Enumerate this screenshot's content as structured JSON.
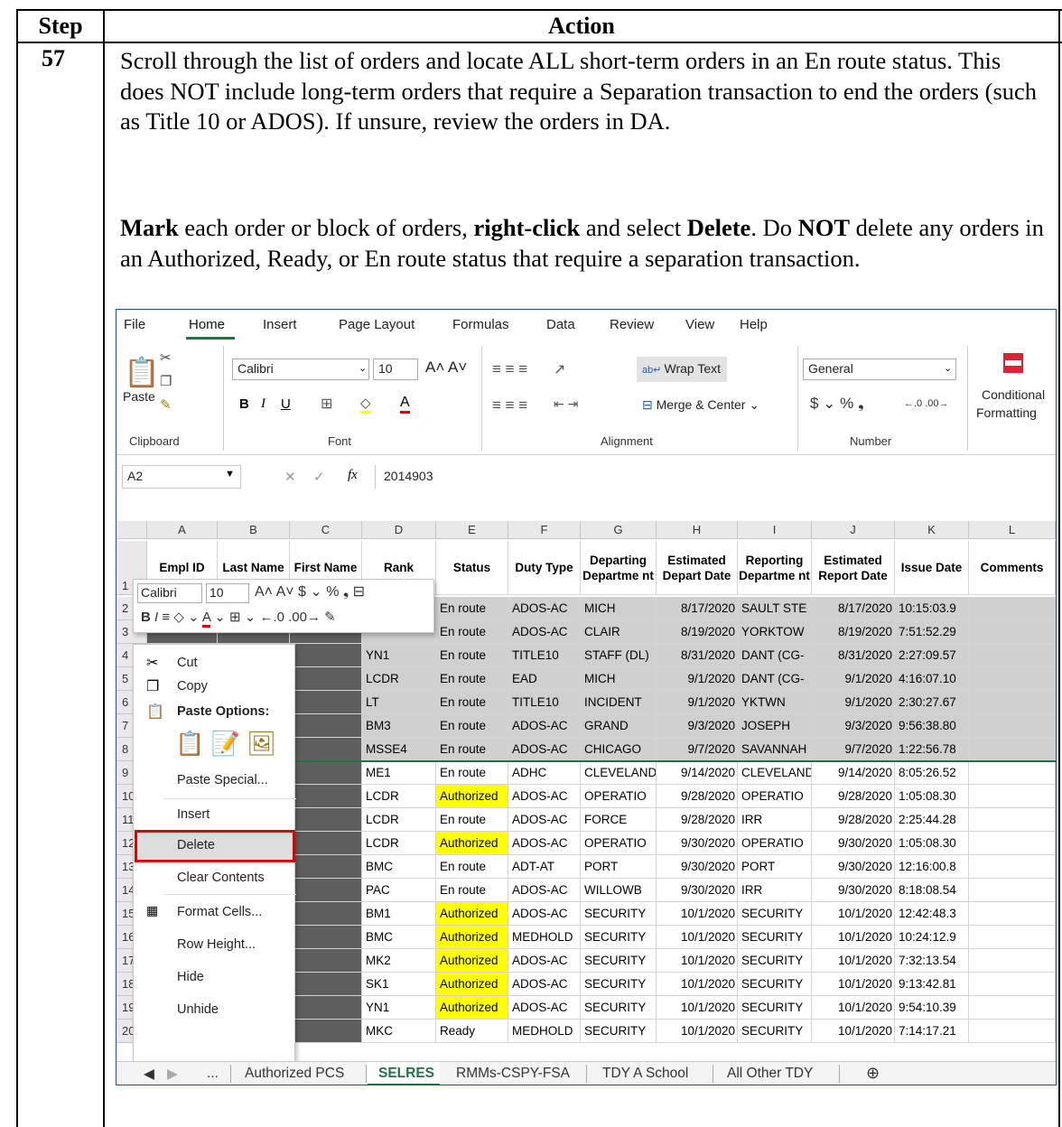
{
  "table": {
    "step_header": "Step",
    "action_header": "Action",
    "step_number": "57"
  },
  "instructions": {
    "p1": "Scroll through the list of orders and locate ALL short-term orders in an En route status.  This does NOT include long-term orders that require a Separation transaction to end the orders (such as Title 10 or ADOS).  If unsure, review the orders in DA.",
    "p2_mark": "Mark",
    "p2_a": " each order or block of orders, ",
    "p2_right": "right-click",
    "p2_b": " and select ",
    "p2_delete": "Delete",
    "p2_c": ".  Do ",
    "p2_not": "NOT",
    "p2_d": " delete any orders in an Authorized, Ready, or En route status that require a separation transaction."
  },
  "excel": {
    "menu": [
      "File",
      "Home",
      "Insert",
      "Page Layout",
      "Formulas",
      "Data",
      "Review",
      "View",
      "Help"
    ],
    "active_menu": "Home",
    "ribbon": {
      "paste": "Paste",
      "font_name": "Calibri",
      "font_size": "10",
      "wrap_text": "Wrap Text",
      "merge_center": "Merge & Center",
      "number_format": "General",
      "conditional": "Conditional",
      "formatting": "Formatting",
      "groups": [
        "Clipboard",
        "Font",
        "Alignment",
        "Number"
      ]
    },
    "name_box": "A2",
    "formula": "2014903",
    "fx": "fx",
    "columns": [
      "A",
      "B",
      "C",
      "D",
      "E",
      "F",
      "G",
      "H",
      "I",
      "J",
      "K",
      "L"
    ],
    "headers": [
      "Empl ID",
      "Last Name",
      "First Name",
      "Rank",
      "Status",
      "Duty Type",
      "Departing Departme nt",
      "Estimated Depart Date",
      "Reporting Departme nt",
      "Estimated Report Date",
      "Issue Date",
      "Comments"
    ],
    "rows": [
      {
        "n": "2",
        "rank": "",
        "status": "En route",
        "duty": "ADOS-AC",
        "dep": "MICH",
        "dd": "8/17/2020",
        "rep": "SAULT STE",
        "rd": "8/17/2020",
        "iss": "10:15:03.9"
      },
      {
        "n": "3",
        "rank": "",
        "status": "En route",
        "duty": "ADOS-AC",
        "dep": "CLAIR",
        "dd": "8/19/2020",
        "rep": "YORKTOW",
        "rd": "8/19/2020",
        "iss": "7:51:52.29"
      },
      {
        "n": "4",
        "rank": "YN1",
        "status": "En route",
        "duty": "TITLE10",
        "dep": "STAFF (DL)",
        "dd": "8/31/2020",
        "rep": "DANT (CG-",
        "rd": "8/31/2020",
        "iss": "2:27:09.57"
      },
      {
        "n": "5",
        "rank": "LCDR",
        "status": "En route",
        "duty": "EAD",
        "dep": "MICH",
        "dd": "9/1/2020",
        "rep": "DANT (CG-",
        "rd": "9/1/2020",
        "iss": "4:16:07.10"
      },
      {
        "n": "6",
        "rank": "LT",
        "status": "En route",
        "duty": "TITLE10",
        "dep": "INCIDENT",
        "dd": "9/1/2020",
        "rep": "YKTWN",
        "rd": "9/1/2020",
        "iss": "2:30:27.67"
      },
      {
        "n": "7",
        "rank": "BM3",
        "status": "En route",
        "duty": "ADOS-AC",
        "dep": "GRAND",
        "dd": "9/3/2020",
        "rep": "JOSEPH",
        "rd": "9/3/2020",
        "iss": "9:56:38.80"
      },
      {
        "n": "8",
        "rank": "MSSE4",
        "status": "En route",
        "duty": "ADOS-AC",
        "dep": "CHICAGO",
        "dd": "9/7/2020",
        "rep": "SAVANNAH",
        "rd": "9/7/2020",
        "iss": "1:22:56.78"
      },
      {
        "n": "9",
        "rank": "ME1",
        "status": "En route",
        "duty": "ADHC",
        "dep": "CLEVELAND",
        "dd": "9/14/2020",
        "rep": "CLEVELAND",
        "rd": "9/14/2020",
        "iss": "8:05:26.52"
      },
      {
        "n": "10",
        "rank": "LCDR",
        "status": "Authorized",
        "duty": "ADOS-AC",
        "dep": "OPERATIO",
        "dd": "9/28/2020",
        "rep": "OPERATIO",
        "rd": "9/28/2020",
        "iss": "1:05:08.30"
      },
      {
        "n": "11",
        "rank": "LCDR",
        "status": "En route",
        "duty": "ADOS-AC",
        "dep": "FORCE",
        "dd": "9/28/2020",
        "rep": "IRR",
        "rd": "9/28/2020",
        "iss": "2:25:44.28"
      },
      {
        "n": "12",
        "rank": "LCDR",
        "status": "Authorized",
        "duty": "ADOS-AC",
        "dep": "OPERATIO",
        "dd": "9/30/2020",
        "rep": "OPERATIO",
        "rd": "9/30/2020",
        "iss": "1:05:08.30"
      },
      {
        "n": "13",
        "rank": "BMC",
        "status": "En route",
        "duty": "ADT-AT",
        "dep": "PORT",
        "dd": "9/30/2020",
        "rep": "PORT",
        "rd": "9/30/2020",
        "iss": "12:16:00.8"
      },
      {
        "n": "14",
        "rank": "PAC",
        "status": "En route",
        "duty": "ADOS-AC",
        "dep": "WILLOWB",
        "dd": "9/30/2020",
        "rep": "IRR",
        "rd": "9/30/2020",
        "iss": "8:18:08.54"
      },
      {
        "n": "15",
        "rank": "BM1",
        "status": "Authorized",
        "duty": "ADOS-AC",
        "dep": "SECURITY",
        "dd": "10/1/2020",
        "rep": "SECURITY",
        "rd": "10/1/2020",
        "iss": "12:42:48.3"
      },
      {
        "n": "16",
        "rank": "BMC",
        "status": "Authorized",
        "duty": "MEDHOLD",
        "dep": "SECURITY",
        "dd": "10/1/2020",
        "rep": "SECURITY",
        "rd": "10/1/2020",
        "iss": "10:24:12.9"
      },
      {
        "n": "17",
        "rank": "MK2",
        "status": "Authorized",
        "duty": "ADOS-AC",
        "dep": "SECURITY",
        "dd": "10/1/2020",
        "rep": "SECURITY",
        "rd": "10/1/2020",
        "iss": "7:32:13.54"
      },
      {
        "n": "18",
        "rank": "SK1",
        "status": "Authorized",
        "duty": "ADOS-AC",
        "dep": "SECURITY",
        "dd": "10/1/2020",
        "rep": "SECURITY",
        "rd": "10/1/2020",
        "iss": "9:13:42.81"
      },
      {
        "n": "19",
        "rank": "YN1",
        "status": "Authorized",
        "duty": "ADOS-AC",
        "dep": "SECURITY",
        "dd": "10/1/2020",
        "rep": "SECURITY",
        "rd": "10/1/2020",
        "iss": "9:54:10.39"
      },
      {
        "n": "20",
        "rank": "MKC",
        "status": "Ready",
        "duty": "MEDHOLD",
        "dep": "SECURITY",
        "dd": "10/1/2020",
        "rep": "SECURITY",
        "rd": "10/1/2020",
        "iss": "7:14:17.21"
      }
    ],
    "mini_toolbar": {
      "font": "Calibri",
      "size": "10"
    },
    "context_menu": {
      "cut": "Cut",
      "copy": "Copy",
      "paste_options": "Paste Options:",
      "paste_special": "Paste Special...",
      "insert": "Insert",
      "delete": "Delete",
      "clear": "Clear Contents",
      "format_cells": "Format Cells...",
      "row_height": "Row Height...",
      "hide": "Hide",
      "unhide": "Unhide"
    },
    "sheet_tabs": [
      "...",
      "Authorized PCS",
      "SELRES",
      "RMMs-CSPY-FSA",
      "TDY A School",
      "All Other TDY"
    ],
    "active_tab": "SELRES",
    "colors": {
      "highlight": "#ffff00",
      "selection": "#d0d0d0",
      "callout": "#e00000",
      "excel_green": "#217346"
    }
  }
}
